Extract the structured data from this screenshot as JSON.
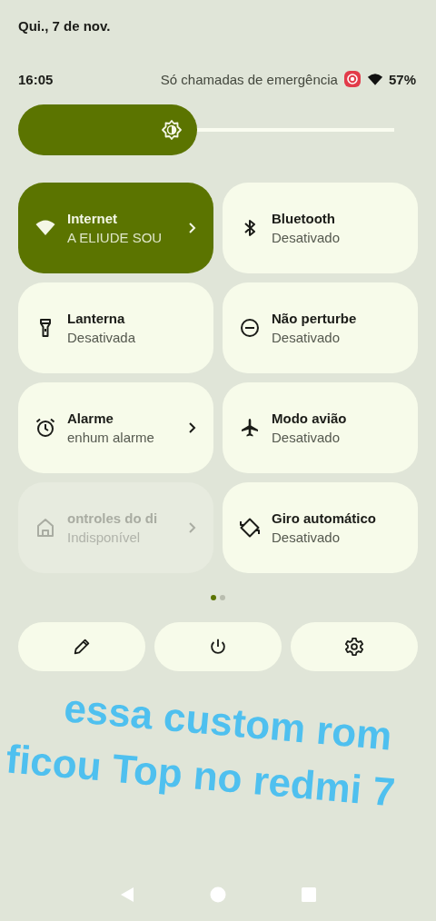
{
  "date": "Qui., 7 de nov.",
  "status_bar": {
    "time": "16:05",
    "carrier": "Só chamadas de emergência",
    "battery": "57%"
  },
  "tiles": [
    {
      "title": "Internet",
      "subtitle": "A ELIUDE SOU",
      "on": true,
      "disabled": false,
      "chevron": true
    },
    {
      "title": "Bluetooth",
      "subtitle": "Desativado",
      "on": false,
      "disabled": false,
      "chevron": false
    },
    {
      "title": "Lanterna",
      "subtitle": "Desativada",
      "on": false,
      "disabled": false,
      "chevron": false
    },
    {
      "title": "Não perturbe",
      "subtitle": "Desativado",
      "on": false,
      "disabled": false,
      "chevron": false
    },
    {
      "title": "Alarme",
      "subtitle": "enhum alarme",
      "on": false,
      "disabled": false,
      "chevron": true
    },
    {
      "title": "Modo avião",
      "subtitle": "Desativado",
      "on": false,
      "disabled": false,
      "chevron": false
    },
    {
      "title": "ontroles do di",
      "subtitle": "Indisponível",
      "on": false,
      "disabled": true,
      "chevron": true
    },
    {
      "title": "Giro automático",
      "subtitle": "Desativado",
      "on": false,
      "disabled": false,
      "chevron": false
    }
  ],
  "pages": [
    {
      "selected": true
    },
    {
      "selected": false
    }
  ],
  "caption": [
    "essa custom rom",
    "ficou Top no redmi 7"
  ]
}
